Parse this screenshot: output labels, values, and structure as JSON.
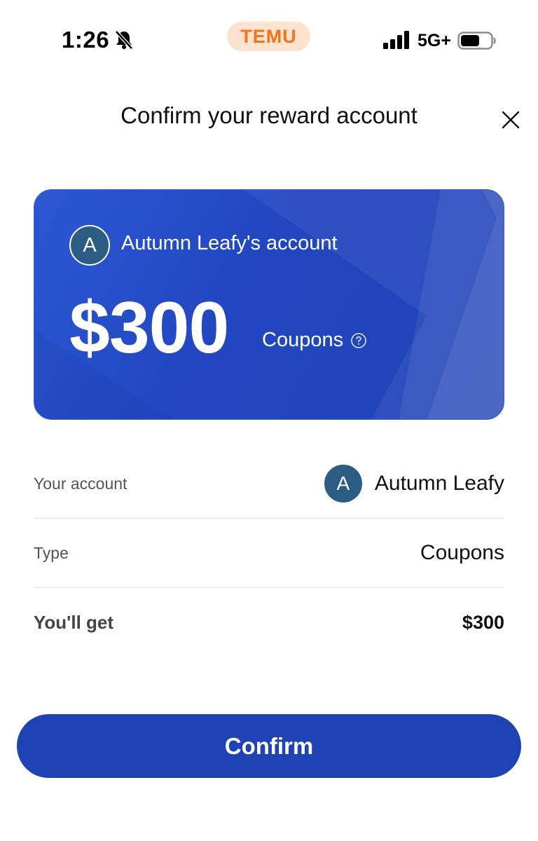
{
  "status_bar": {
    "time": "1:26",
    "app_name": "TEMU",
    "network": "5G+",
    "icons": [
      "bell-slash-icon",
      "signal-icon",
      "battery-icon"
    ]
  },
  "header": {
    "title": "Confirm your reward account",
    "close_icon": "close-icon"
  },
  "card": {
    "avatar_letter": "A",
    "account_name": "Autumn Leafy's account",
    "amount": "$300",
    "type_label": "Coupons",
    "help_icon": "question-circle-icon"
  },
  "details": {
    "account_label": "Your account",
    "account_avatar_letter": "A",
    "account_value": "Autumn Leafy",
    "type_label": "Type",
    "type_value": "Coupons",
    "get_label": "You'll get",
    "get_value": "$300"
  },
  "actions": {
    "confirm_label": "Confirm"
  },
  "colors": {
    "brand_orange": "#f2741b",
    "card_blue": "#2146c0",
    "button_blue": "#1f43b3",
    "avatar": "#2b5d84"
  }
}
